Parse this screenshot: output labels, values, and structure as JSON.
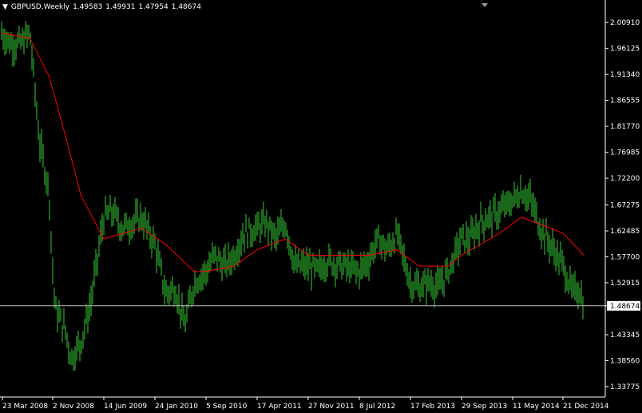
{
  "header": {
    "symbol_timeframe": "GBPUSD,Weekly",
    "open": "1.49583",
    "high": "1.49931",
    "low": "1.47954",
    "close": "1.48674"
  },
  "colors": {
    "background": "#000000",
    "axis_and_text": "#ffffff",
    "bars": "#33cc33",
    "moving_average": "#ff0000",
    "price_line": "#c0c0c0",
    "price_label_bg": "#ffffff",
    "price_label_text": "#000000"
  },
  "icons": {
    "menu": "triangle-down-icon",
    "shift_marker": "triangle-down-icon"
  },
  "chart_data": {
    "type": "ohlc",
    "series": [
      {
        "name": "",
        "points": [
          {
            "date": "23 Mar 2008",
            "close": 1.99
          },
          {
            "date": "2 May 2008",
            "close": 1.97
          },
          {
            "date": "13 Jun 2008",
            "close": 1.97
          },
          {
            "date": "25 Jul 2008",
            "close": 1.99
          },
          {
            "date": "5 Sep 2008",
            "close": 1.79
          },
          {
            "date": "17 Oct 2008",
            "close": 1.7
          },
          {
            "date": "2 Nov 2008",
            "close": 1.55
          },
          {
            "date": "14 Nov 2008",
            "close": 1.48
          },
          {
            "date": "28 Dec 2008",
            "close": 1.44
          },
          {
            "date": "23 Jan 2009",
            "close": 1.39
          },
          {
            "date": "6 Mar 2009",
            "close": 1.42
          },
          {
            "date": "17 Apr 2009",
            "close": 1.49
          },
          {
            "date": "14 Jun 2009",
            "close": 1.65
          },
          {
            "date": "24 Jul 2009",
            "close": 1.66
          },
          {
            "date": "4 Sep 2009",
            "close": 1.63
          },
          {
            "date": "16 Oct 2009",
            "close": 1.64
          },
          {
            "date": "27 Nov 2009",
            "close": 1.65
          },
          {
            "date": "24 Jan 2010",
            "close": 1.6
          },
          {
            "date": "12 Mar 2010",
            "close": 1.51
          },
          {
            "date": "23 Apr 2010",
            "close": 1.52
          },
          {
            "date": "4 Jun 2010",
            "close": 1.45
          },
          {
            "date": "16 Jul 2010",
            "close": 1.53
          },
          {
            "date": "5 Sep 2010",
            "close": 1.55
          },
          {
            "date": "15 Oct 2010",
            "close": 1.58
          },
          {
            "date": "26 Nov 2010",
            "close": 1.56
          },
          {
            "date": "7 Jan 2011",
            "close": 1.58
          },
          {
            "date": "18 Feb 2011",
            "close": 1.62
          },
          {
            "date": "17 Apr 2011",
            "close": 1.63
          },
          {
            "date": "27 May 2011",
            "close": 1.64
          },
          {
            "date": "8 Jul 2011",
            "close": 1.61
          },
          {
            "date": "19 Aug 2011",
            "close": 1.64
          },
          {
            "date": "30 Sep 2011",
            "close": 1.56
          },
          {
            "date": "27 Nov 2011",
            "close": 1.56
          },
          {
            "date": "6 Jan 2012",
            "close": 1.55
          },
          {
            "date": "17 Feb 2012",
            "close": 1.57
          },
          {
            "date": "8 Jul 2012",
            "close": 1.55
          },
          {
            "date": "17 Aug 2012",
            "close": 1.57
          },
          {
            "date": "28 Sep 2012",
            "close": 1.61
          },
          {
            "date": "9 Nov 2012",
            "close": 1.59
          },
          {
            "date": "21 Dec 2012",
            "close": 1.62
          },
          {
            "date": "17 Feb 2013",
            "close": 1.53
          },
          {
            "date": "29 Mar 2013",
            "close": 1.52
          },
          {
            "date": "10 May 2013",
            "close": 1.53
          },
          {
            "date": "21 Jun 2013",
            "close": 1.52
          },
          {
            "date": "2 Aug 2013",
            "close": 1.55
          },
          {
            "date": "29 Sep 2013",
            "close": 1.61
          },
          {
            "date": "8 Nov 2013",
            "close": 1.61
          },
          {
            "date": "20 Dec 2013",
            "close": 1.64
          },
          {
            "date": "31 Jan 2014",
            "close": 1.65
          },
          {
            "date": "14 Mar 2014",
            "close": 1.66
          },
          {
            "date": "11 May 2014",
            "close": 1.68
          },
          {
            "date": "20 Jun 2014",
            "close": 1.7
          },
          {
            "date": "1 Aug 2014",
            "close": 1.68
          },
          {
            "date": "12 Sep 2014",
            "close": 1.63
          },
          {
            "date": "24 Oct 2014",
            "close": 1.6
          },
          {
            "date": "21 Dec 2014",
            "close": 1.56
          },
          {
            "date": "30 Jan 2015",
            "close": 1.51
          },
          {
            "date": "27 Feb 2015",
            "close": 1.52
          },
          {
            "date": "20 Mar 2015",
            "close": 1.48674
          }
        ]
      },
      {
        "name": "",
        "points": [
          {
            "date": "23 Mar 2008",
            "value": 1.99
          },
          {
            "date": "25 Jul 2008",
            "value": 1.98
          },
          {
            "date": "17 Oct 2008",
            "value": 1.91
          },
          {
            "date": "28 Dec 2008",
            "value": 1.8
          },
          {
            "date": "6 Mar 2009",
            "value": 1.69
          },
          {
            "date": "14 Jun 2009",
            "value": 1.61
          },
          {
            "date": "27 Nov 2009",
            "value": 1.63
          },
          {
            "date": "12 Mar 2010",
            "value": 1.6
          },
          {
            "date": "16 Jul 2010",
            "value": 1.55
          },
          {
            "date": "5 Sep 2010",
            "value": 1.55
          },
          {
            "date": "7 Jan 2011",
            "value": 1.56
          },
          {
            "date": "17 Apr 2011",
            "value": 1.59
          },
          {
            "date": "19 Aug 2011",
            "value": 1.61
          },
          {
            "date": "27 Nov 2011",
            "value": 1.58
          },
          {
            "date": "17 Aug 2012",
            "value": 1.58
          },
          {
            "date": "21 Dec 2012",
            "value": 1.59
          },
          {
            "date": "29 Mar 2013",
            "value": 1.56
          },
          {
            "date": "2 Aug 2013",
            "value": 1.56
          },
          {
            "date": "29 Sep 2013",
            "value": 1.58
          },
          {
            "date": "14 Mar 2014",
            "value": 1.62
          },
          {
            "date": "20 Jun 2014",
            "value": 1.65
          },
          {
            "date": "24 Oct 2014",
            "value": 1.63
          },
          {
            "date": "21 Dec 2014",
            "value": 1.62
          },
          {
            "date": "20 Mar 2015",
            "value": 1.58
          }
        ]
      }
    ],
    "yticks": [
      "2.00910",
      "1.96125",
      "1.91340",
      "1.86555",
      "1.81770",
      "1.76985",
      "1.72200",
      "1.67275",
      "1.62485",
      "1.57700",
      "1.52915",
      "1.48674",
      "1.43345",
      "1.38560",
      "1.33775"
    ],
    "xticks": [
      "23 Mar 2008",
      "2 Nov 2008",
      "14 Jun 2009",
      "24 Jan 2010",
      "5 Sep 2010",
      "17 Apr 2011",
      "27 Nov 2011",
      "8 Jul 2012",
      "17 Feb 2013",
      "29 Sep 2013",
      "11 May 2014",
      "21 Dec 2014"
    ],
    "ylim": [
      1.32,
      2.03
    ],
    "current_price": 1.48674,
    "grid": false
  }
}
